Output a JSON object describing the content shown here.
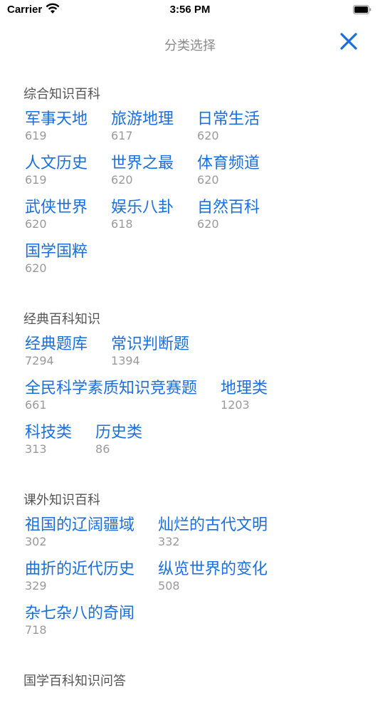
{
  "status_bar": {
    "carrier": "Carrier",
    "time": "3:56 PM"
  },
  "nav": {
    "title": "分类选择",
    "close_icon": "close-icon"
  },
  "colors": {
    "accent": "#1a6fdc",
    "count": "#9a9a9a",
    "section_title": "#555555"
  },
  "sections": [
    {
      "title": "综合知识百科",
      "items": [
        {
          "label": "军事天地",
          "count": "619"
        },
        {
          "label": "旅游地理",
          "count": "617"
        },
        {
          "label": "日常生活",
          "count": "620"
        },
        {
          "label": "人文历史",
          "count": "619"
        },
        {
          "label": "世界之最",
          "count": "620"
        },
        {
          "label": "体育频道",
          "count": "620"
        },
        {
          "label": "武侠世界",
          "count": "620"
        },
        {
          "label": "娱乐八卦",
          "count": "618"
        },
        {
          "label": "自然百科",
          "count": "620"
        },
        {
          "label": "国学国粹",
          "count": "620"
        }
      ]
    },
    {
      "title": "经典百科知识",
      "items": [
        {
          "label": "经典题库",
          "count": "7294"
        },
        {
          "label": "常识判断题",
          "count": "1394"
        },
        {
          "label": "全民科学素质知识竞赛题",
          "count": "661"
        },
        {
          "label": "地理类",
          "count": "1203"
        },
        {
          "label": "科技类",
          "count": "313"
        },
        {
          "label": "历史类",
          "count": "86"
        }
      ]
    },
    {
      "title": "课外知识百科",
      "items": [
        {
          "label": "祖国的辽阔疆域",
          "count": "302"
        },
        {
          "label": "灿烂的古代文明",
          "count": "332"
        },
        {
          "label": "曲折的近代历史",
          "count": "329"
        },
        {
          "label": "纵览世界的变化",
          "count": "508"
        },
        {
          "label": "杂七杂八的奇闻",
          "count": "718"
        }
      ]
    },
    {
      "title": "国学百科知识问答",
      "items": []
    }
  ]
}
